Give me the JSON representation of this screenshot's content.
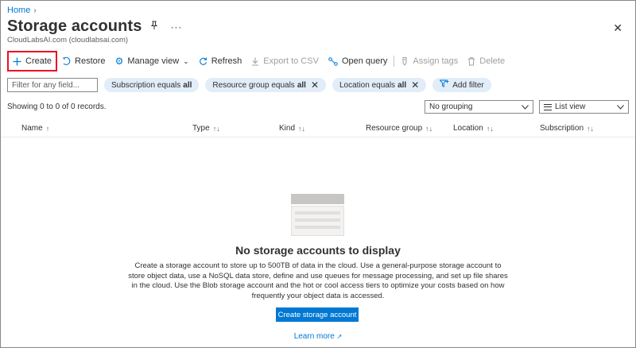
{
  "breadcrumb": {
    "home": "Home",
    "separator": ">"
  },
  "header": {
    "title": "Storage accounts",
    "subtitle": "CloudLabsAI.com (cloudlabsai.com)",
    "more": "···",
    "close": "✕"
  },
  "toolbar": {
    "create": "Create",
    "restore": "Restore",
    "manage_view": "Manage view",
    "refresh": "Refresh",
    "export_csv": "Export to CSV",
    "open_query": "Open query",
    "assign_tags": "Assign tags",
    "delete": "Delete"
  },
  "filters": {
    "search_placeholder": "Filter for any field...",
    "subscription_label": "Subscription equals",
    "subscription_value": "all",
    "resource_group_label": "Resource group equals",
    "resource_group_value": "all",
    "location_label": "Location equals",
    "location_value": "all",
    "add_filter": "Add filter"
  },
  "records": "Showing 0 to 0 of 0 records.",
  "grouping": {
    "selected": "No grouping"
  },
  "view": {
    "selected": "List view"
  },
  "table": {
    "columns": [
      "Name",
      "Type",
      "Kind",
      "Resource group",
      "Location",
      "Subscription"
    ]
  },
  "empty_state": {
    "title": "No storage accounts to display",
    "description": "Create a storage account to store up to 500TB of data in the cloud. Use a general-purpose storage account to store object data, use a NoSQL data store, define and use queues for message processing, and set up file shares in the cloud. Use the Blob storage account and the hot or cool access tiers to optimize your costs based on how frequently your object data is accessed.",
    "button": "Create storage account",
    "learn_more": "Learn more"
  },
  "colors": {
    "accent": "#0078d4",
    "pill_bg": "#e1edf9",
    "create_highlight": "#e81123"
  }
}
